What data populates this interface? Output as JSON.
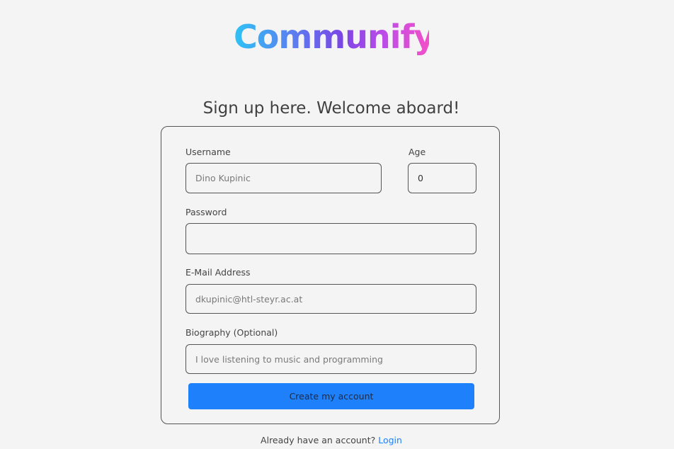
{
  "brand": {
    "name": "Communify"
  },
  "heading": "Sign up here. Welcome aboard!",
  "form": {
    "username": {
      "label": "Username",
      "placeholder": "Dino Kupinic"
    },
    "age": {
      "label": "Age",
      "value": "0"
    },
    "password": {
      "label": "Password",
      "placeholder": ""
    },
    "email": {
      "label": "E-Mail Address",
      "placeholder": "dkupinic@htl-steyr.ac.at"
    },
    "biography": {
      "label": "Biography (Optional)",
      "placeholder": "I love listening to music and programming"
    },
    "submit_label": "Create my account"
  },
  "footer": {
    "prompt": "Already have an account?",
    "login_link": "Login"
  }
}
